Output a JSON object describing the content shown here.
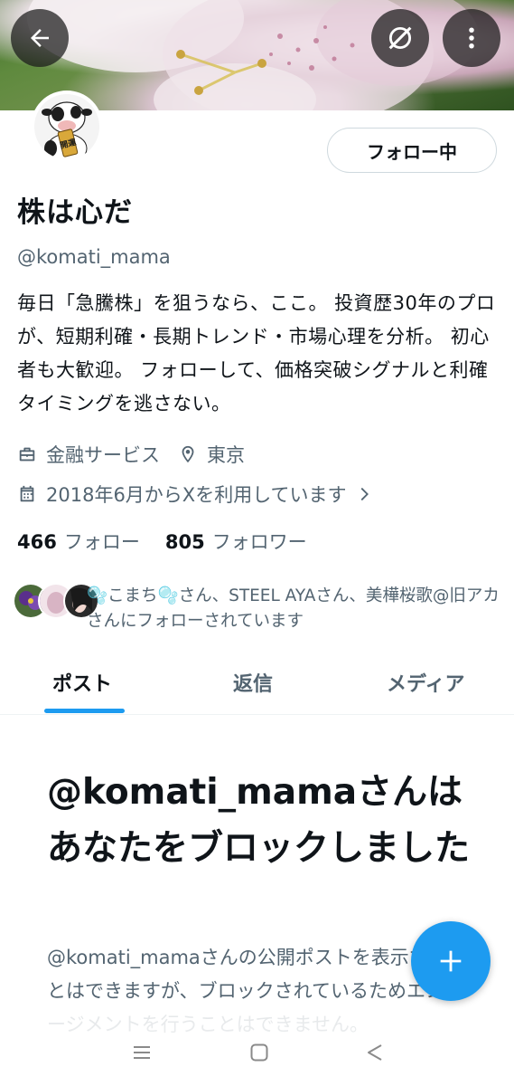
{
  "header": {
    "back_icon": "arrow-left-icon",
    "grok_icon": "grok-icon",
    "more_icon": "more-vertical-icon"
  },
  "profile": {
    "avatar_text": "開運",
    "follow_button_label": "フォロー中",
    "display_name": "株は心だ",
    "handle": "@komati_mama",
    "bio": "毎日「急騰株」を狙うなら、ここ。 投資歴30年のプロが、短期利確・長期トレンド・市場心理を分析。 初心者も大歓迎。 フォローして、価格突破シグナルと利確タイミングを逃さない。",
    "category": "金融サービス",
    "location": "東京",
    "joined": "2018年6月からXを利用しています",
    "following_count": "466",
    "following_label": "フォロー",
    "followers_count": "805",
    "followers_label": "フォロワー",
    "followed_by_text": "🫧こまち🫧さん、STEEL AYAさん、美樺桜歌@旧アカさんにフォローされています"
  },
  "tabs": [
    {
      "label": "ポスト",
      "active": true
    },
    {
      "label": "返信",
      "active": false
    },
    {
      "label": "メディア",
      "active": false
    }
  ],
  "blocked": {
    "title": "@komati_mamaさんはあなたをブロックしました",
    "body": "@komati_mamaさんの公開ポストを表示することはできますが、ブロックされているためエンゲージメントを行うことはできません。"
  },
  "colors": {
    "accent": "#1d9bf0",
    "text_primary": "#0f1419",
    "text_secondary": "#536471"
  },
  "navbar": {
    "icons": [
      "recent-apps-icon",
      "home-icon",
      "back-triangle-icon"
    ]
  }
}
